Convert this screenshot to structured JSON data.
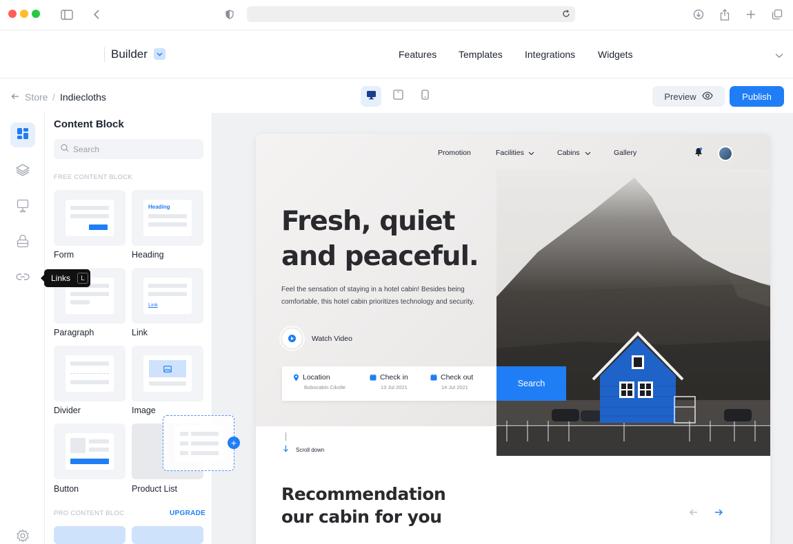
{
  "app": {
    "brand": "Builder",
    "nav": [
      "Features",
      "Templates",
      "Integrations",
      "Widgets"
    ]
  },
  "breadcrumb": {
    "store": "Store",
    "separator": "/",
    "current": "Indiecloths"
  },
  "toolbar": {
    "preview_label": "Preview",
    "publish_label": "Publish"
  },
  "tooltip": {
    "label": "Links",
    "shortcut": "L"
  },
  "panel": {
    "title": "Content Block",
    "search_placeholder": "Search",
    "free_section": "FREE CONTENT BLOCK",
    "pro_section": "PRO CONTENT  BLOC",
    "upgrade_label": "UPGRADE",
    "blocks": [
      "Form",
      "Heading",
      "Paragraph",
      "Link",
      "Divider",
      "Image",
      "Button",
      "Product List"
    ],
    "heading_thumb_text": "Heading",
    "link_thumb_text": "Link"
  },
  "site": {
    "nav": [
      "Promotion",
      "Facilities",
      "Cabins",
      "Gallery"
    ],
    "hero_title_line1": "Fresh, quiet",
    "hero_title_line2": "and peaceful.",
    "hero_desc": "Feel the sensation of staying in a hotel cabin! Besides being comfortable, this hotel cabin prioritizes technology and security.",
    "watch_video": "Watch Video",
    "booking": {
      "location_label": "Location",
      "location_value": "Bobocabin Cikolle",
      "checkin_label": "Check in",
      "checkin_value": "13 Jul 2021",
      "checkout_label": "Check out",
      "checkout_value": "14 Jul 2021",
      "search_label": "Search"
    },
    "scroll_label": "Scroll down",
    "rec_line1": "Recommendation",
    "rec_line2": "our cabin for you"
  },
  "colors": {
    "accent": "#1f7ef5",
    "accent_light": "#cfe2fb"
  },
  "icons": [
    "sidebar-icon",
    "back-icon",
    "shield-icon",
    "reload-icon",
    "download-icon",
    "share-icon",
    "plus-icon",
    "tabs-icon",
    "dashboard-icon",
    "layers-icon",
    "frame-icon",
    "lock-icon",
    "link-icon",
    "settings-icon",
    "desktop-icon",
    "tablet-icon",
    "mobile-icon",
    "eye-icon",
    "bell-icon",
    "play-icon",
    "pin-icon",
    "calendar-icon",
    "arrow-down-icon",
    "arrow-left-icon",
    "arrow-right-icon"
  ]
}
